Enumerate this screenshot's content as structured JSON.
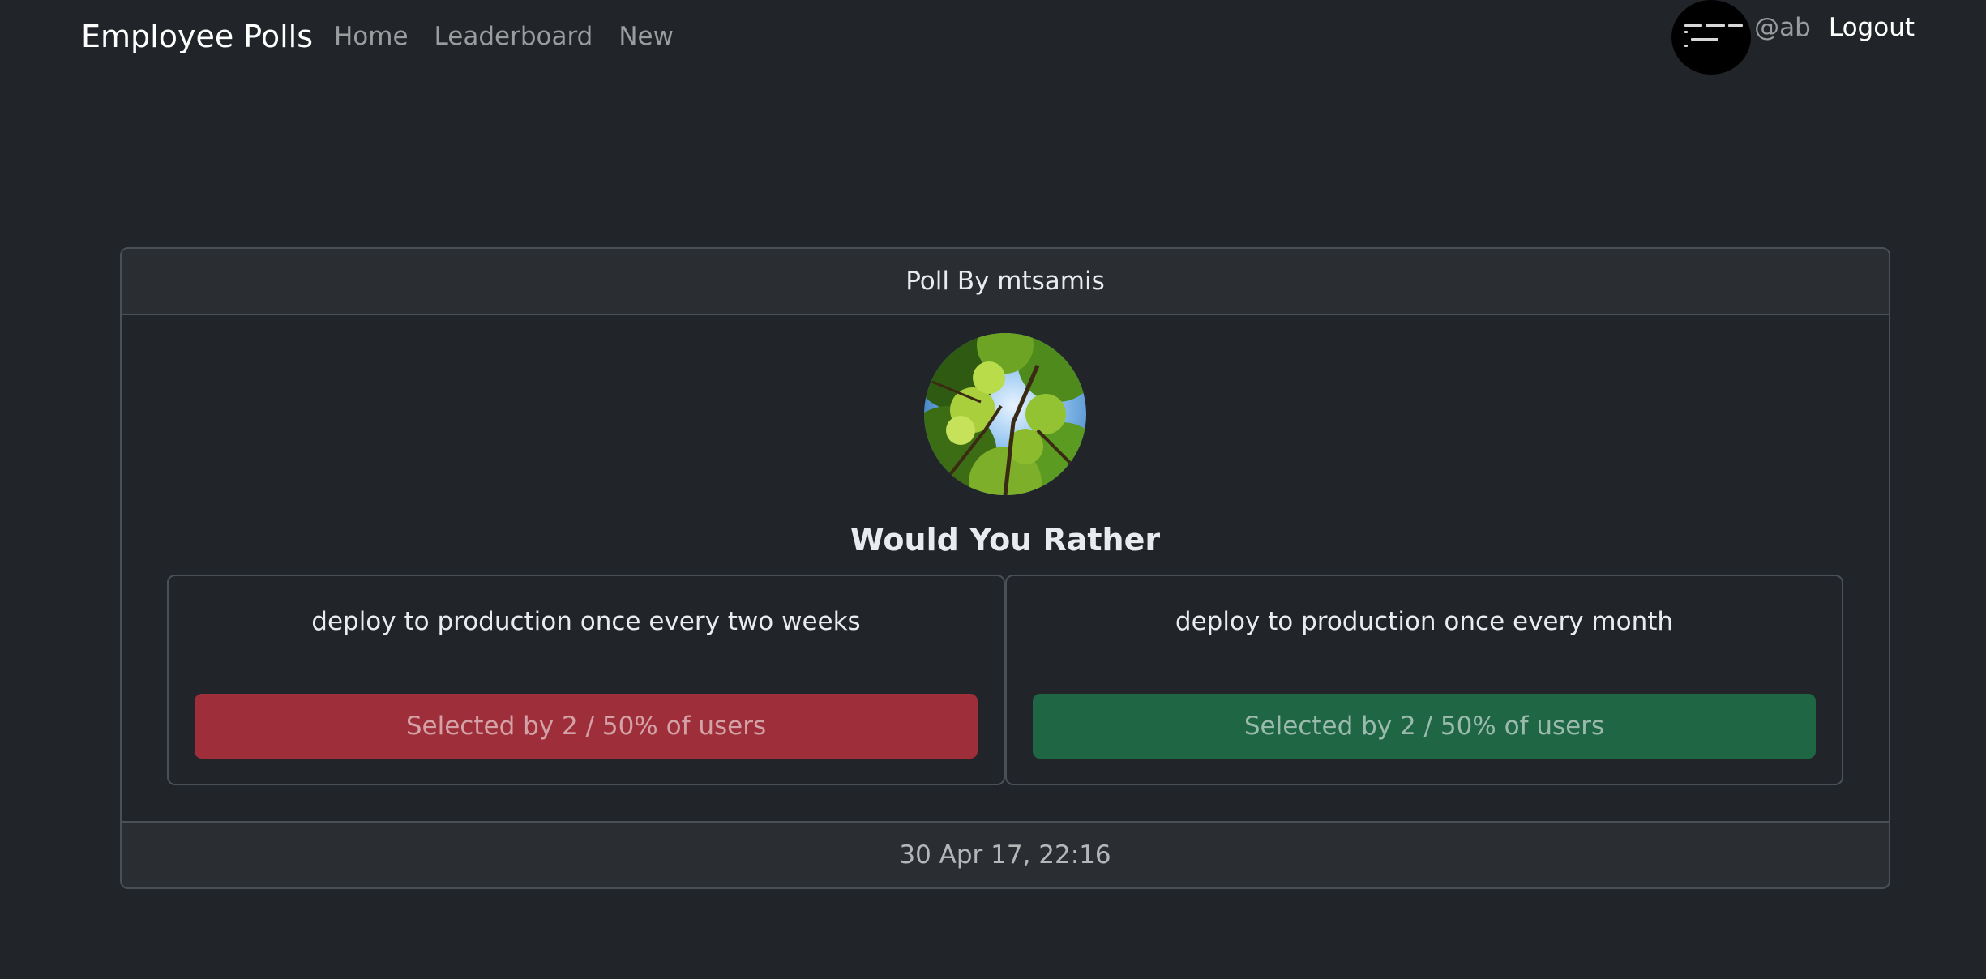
{
  "navbar": {
    "brand": "Employee Polls",
    "links": [
      {
        "label": "Home"
      },
      {
        "label": "Leaderboard"
      },
      {
        "label": "New"
      }
    ],
    "user_handle": "@ab",
    "logout_label": "Logout"
  },
  "poll": {
    "header": "Poll By mtsamis",
    "title": "Would You Rather",
    "options": [
      {
        "text": "deploy to production once every two weeks",
        "result": "Selected by 2 / 50% of users",
        "color": "#9e2f3a"
      },
      {
        "text": "deploy to production once every month",
        "result": "Selected by 2 / 50% of users",
        "color": "#1f6645"
      }
    ],
    "timestamp": "30 Apr 17, 22:16"
  },
  "colors": {
    "background": "#212529",
    "border": "#495057",
    "danger": "#9e2f3a",
    "success": "#1f6645"
  }
}
